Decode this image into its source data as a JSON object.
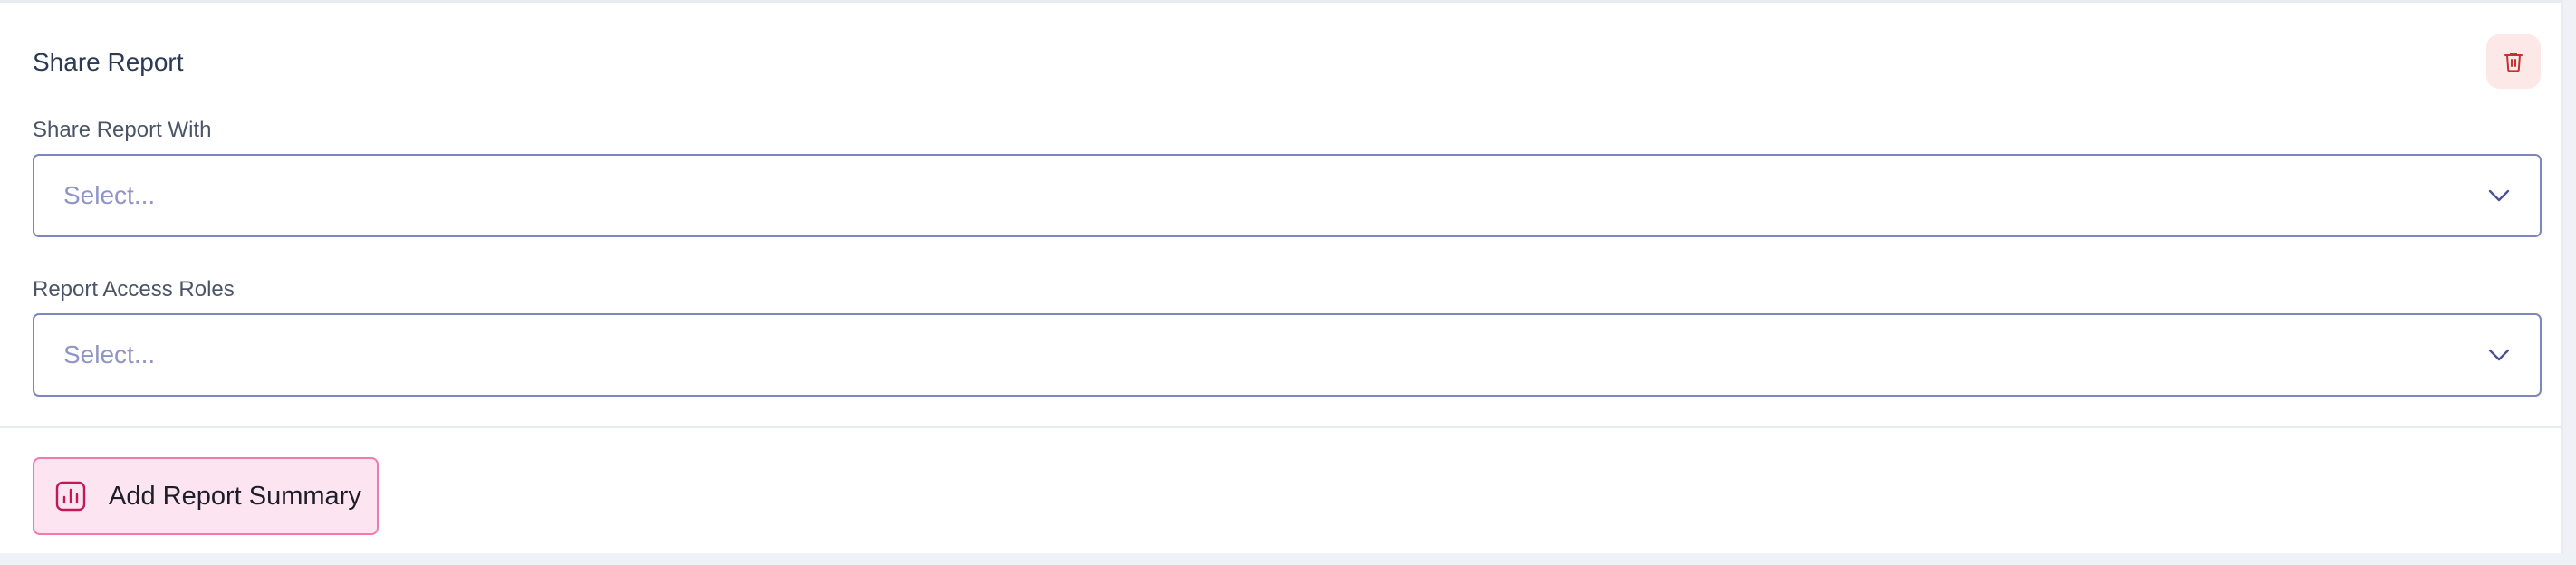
{
  "section": {
    "title": "Share Report"
  },
  "fields": {
    "share_with": {
      "label": "Share Report With",
      "placeholder": "Select..."
    },
    "access_roles": {
      "label": "Report Access Roles",
      "placeholder": "Select..."
    }
  },
  "actions": {
    "add_summary_label": "Add Report Summary"
  },
  "icons": {
    "delete": "trash-icon",
    "dropdown": "chevron-down-icon",
    "summary": "bar-chart-icon"
  },
  "colors": {
    "delete_bg": "#fde8e8",
    "delete_icon": "#c53030",
    "select_border": "#7d86bd",
    "placeholder": "#8e94c4",
    "summary_bg": "#fce4f0",
    "summary_border": "#f07ab0",
    "summary_icon": "#c2185b"
  }
}
